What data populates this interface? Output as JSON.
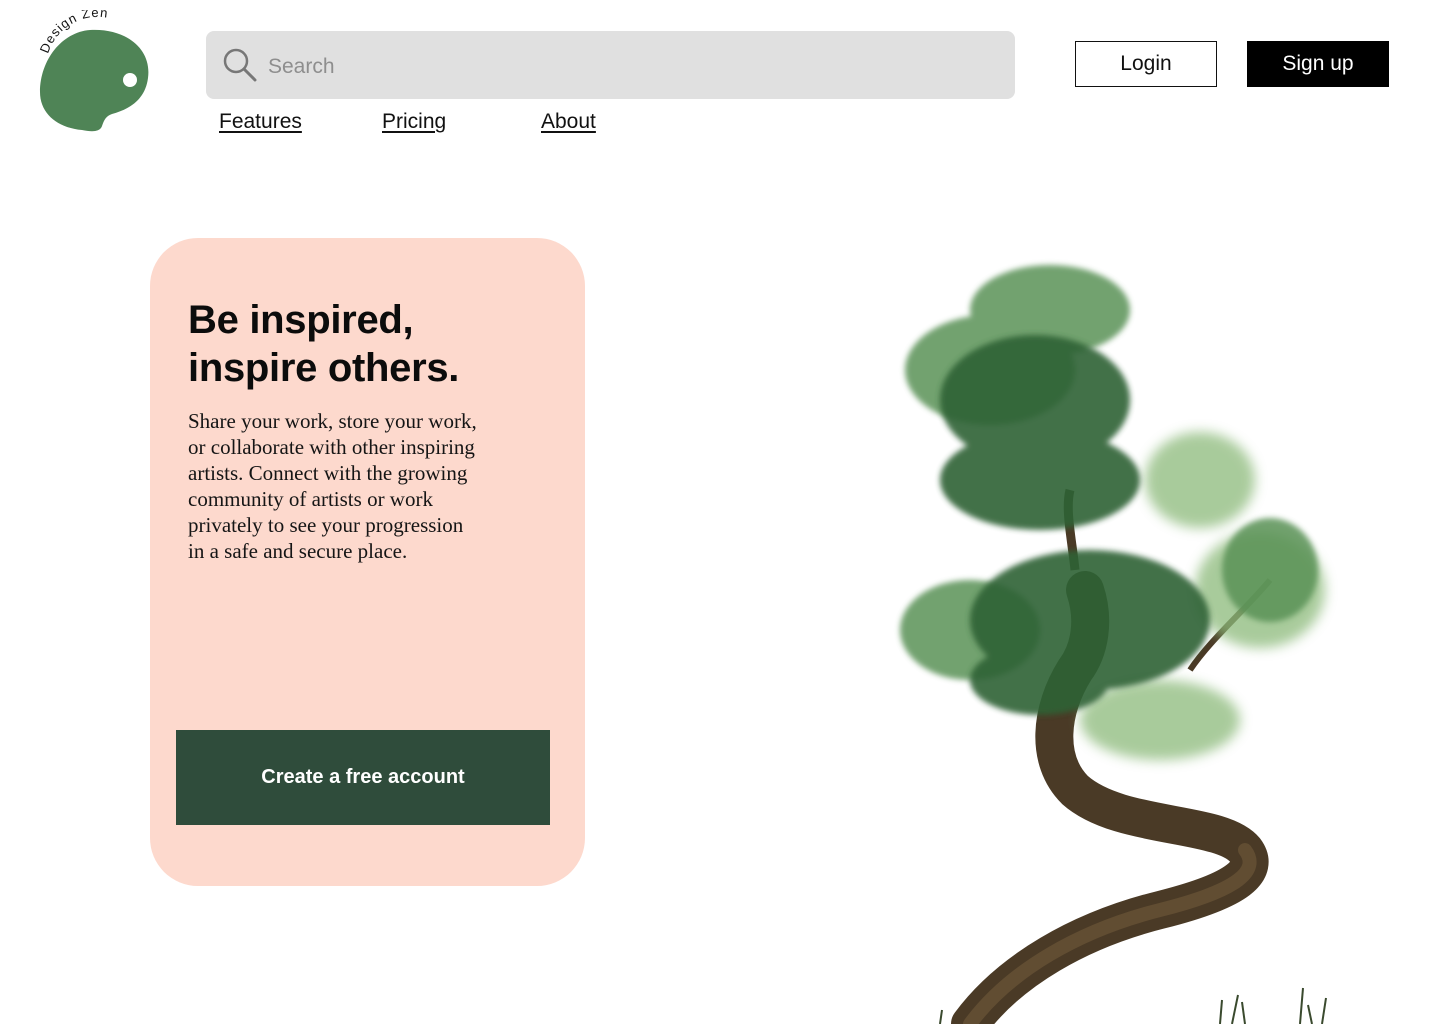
{
  "brand": {
    "name": "Design Zen",
    "logo_color": "#4f8456"
  },
  "search": {
    "placeholder": "Search",
    "value": ""
  },
  "nav": {
    "items": [
      {
        "label": "Features"
      },
      {
        "label": "Pricing"
      },
      {
        "label": "About"
      }
    ]
  },
  "auth": {
    "login_label": "Login",
    "signup_label": "Sign up"
  },
  "hero": {
    "title_line1": "Be inspired,",
    "title_line2": "inspire others.",
    "body": "Share your work, store your work, or collaborate with other inspiring artists. Connect with the growing community of artists or work privately to see your progression in a safe and secure place.",
    "cta_label": "Create a free account",
    "card_color": "#fdd9cd",
    "cta_color": "#2f4c3b"
  },
  "illustration": {
    "icon": "watercolor-bonsai-tree",
    "foliage_color": "#3f7a45",
    "trunk_color": "#4a3a26"
  }
}
